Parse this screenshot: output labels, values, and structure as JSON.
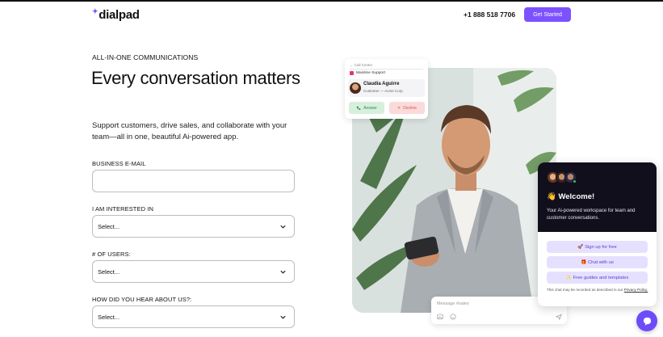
{
  "header": {
    "logo_text": "dialpad",
    "phone": "+1 888 518 7706",
    "cta_label": "Get Started"
  },
  "hero": {
    "eyebrow": "ALL-IN-ONE COMMUNICATIONS",
    "title": "Every conversation matters",
    "subtitle": "Support customers, drive sales, and collaborate with your team—all in one, beautiful Ai-powered app."
  },
  "form": {
    "email_label": "BUSINESS E-MAIL",
    "email_value": "",
    "interest_label": "I AM INTERESTED IN",
    "interest_value": "Select...",
    "users_label": "# OF USERS:",
    "users_value": "Select...",
    "source_label": "HOW DID YOU HEAR ABOUT US?:",
    "source_value": "Select..."
  },
  "call_card": {
    "header": "Call Center",
    "tag": "Mainline Support",
    "caller_name": "Claudia Aguirre",
    "caller_role": "Customer — Acme Corp",
    "answer_label": "Answer",
    "decline_label": "Decline"
  },
  "chat_widget": {
    "welcome": "👋 Welcome!",
    "description": "Your Ai-powered workspace for team and customer conversations.",
    "buttons": [
      {
        "label": "🚀 Sign up for free"
      },
      {
        "label": "🎁 Chat with us"
      },
      {
        "label": "✨ Free guides and templates"
      }
    ],
    "note": "This chat may be recorded as described in our",
    "note_link": "Privacy Policy."
  },
  "message_bar": {
    "placeholder": "Message #sales"
  },
  "colors": {
    "brand": "#7c52ff",
    "chat_header_bg": "#120f1d",
    "answer": "#2e8b4a",
    "decline": "#e35454"
  }
}
